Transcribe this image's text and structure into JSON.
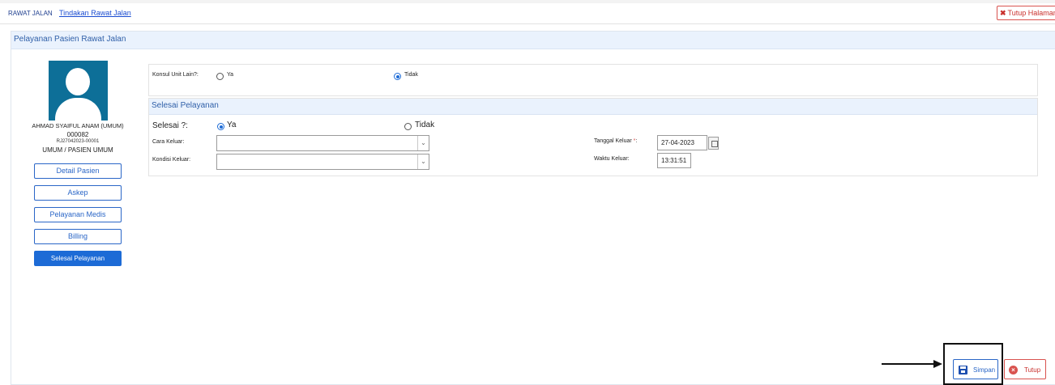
{
  "breadcrumb": {
    "root": "RAWAT JALAN",
    "current": "Tindakan Rawat Jalan"
  },
  "header": {
    "close_page_label": "Tutup Halaman",
    "close_icon": "close-x-icon"
  },
  "panel": {
    "title": "Pelayanan Pasien Rawat Jalan"
  },
  "patient": {
    "name": "AHMAD SYAIFUL ANAM (UMUM)",
    "number": "000082",
    "registration": "RJ27042023-00001",
    "category": "UMUM / PASIEN UMUM",
    "avatar_icon": "user-silhouette-icon"
  },
  "side_menu": {
    "items": [
      {
        "label": "Detail Pasien"
      },
      {
        "label": "Askep"
      },
      {
        "label": "Pelayanan Medis"
      },
      {
        "label": "Billing"
      },
      {
        "label": "Selesai Pelayanan",
        "active": true
      }
    ]
  },
  "konsul": {
    "label": "Konsul Unit Lain?:",
    "options": [
      {
        "label": "Ya",
        "selected": false
      },
      {
        "label": "Tidak",
        "selected": true
      }
    ]
  },
  "selesai_section": {
    "title": "Selesai Pelayanan",
    "selesai_label": "Selesai ?:",
    "options": [
      {
        "label": "Ya",
        "selected": true
      },
      {
        "label": "Tidak",
        "selected": false
      }
    ],
    "cara_keluar_label": "Cara Keluar:",
    "cara_keluar_value": "",
    "kondisi_keluar_label": "Kondisi Keluar:",
    "kondisi_keluar_value": "",
    "tanggal_keluar_label": "Tanggal Keluar",
    "required_mark": "*",
    "tanggal_keluar_suffix": ":",
    "tanggal_keluar_value": "27-04-2023",
    "waktu_keluar_label": "Waktu Keluar:",
    "waktu_keluar_value": "13:31:51",
    "calendar_icon": "calendar-icon"
  },
  "footer": {
    "save_label": "Simpan",
    "save_icon": "floppy-disk-icon",
    "close_label": "Tutup",
    "close_icon": "close-circle-icon"
  },
  "colors": {
    "primary": "#1d6bd6",
    "danger": "#d9534f",
    "section_header_bg": "#eaf2fd",
    "avatar_bg": "#0d6f98"
  }
}
